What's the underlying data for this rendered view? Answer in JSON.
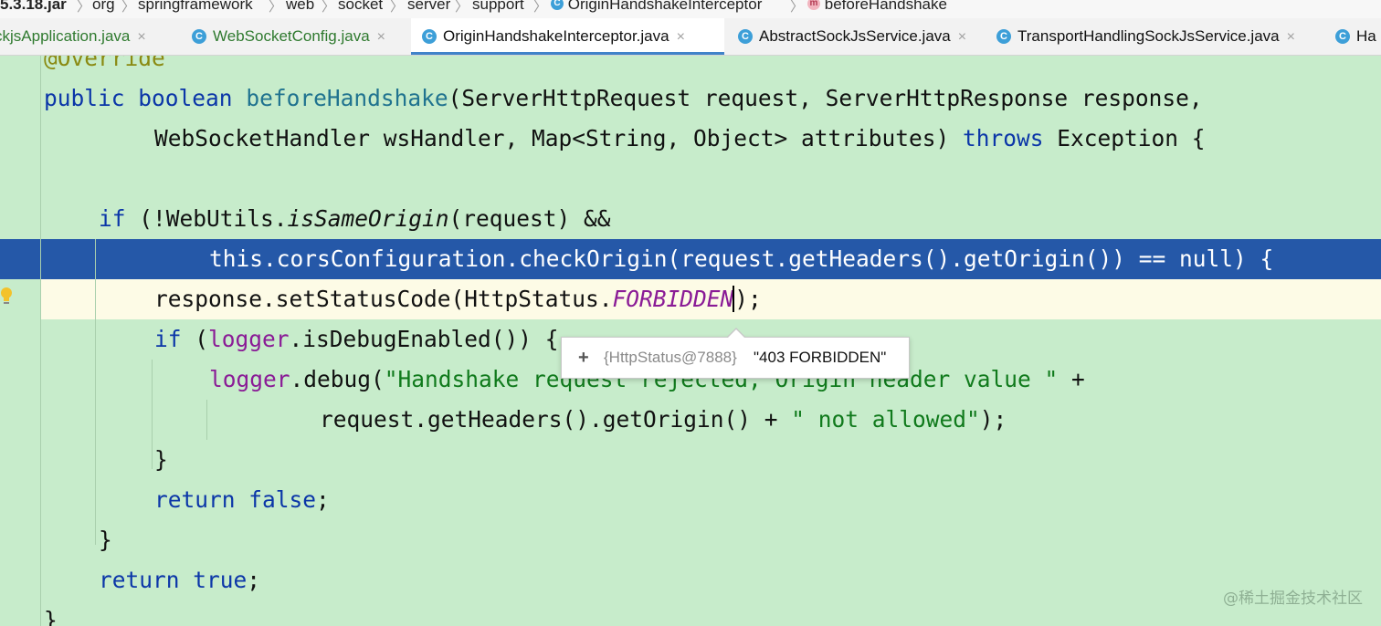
{
  "breadcrumb": {
    "jar": "5.3.18.jar",
    "parts": [
      "org",
      "springframework",
      "web",
      "socket",
      "server",
      "support"
    ],
    "class_name": "OriginHandshakeInterceptor",
    "method_name": "beforeHandshake",
    "class_icon": "C",
    "method_icon": "m"
  },
  "tabs": [
    {
      "label": "ckjsApplication.java"
    },
    {
      "label": "WebSocketConfig.java"
    },
    {
      "label": "OriginHandshakeInterceptor.java"
    },
    {
      "label": "AbstractSockJsService.java"
    },
    {
      "label": "TransportHandlingSockJsService.java"
    },
    {
      "label": "Ha"
    }
  ],
  "close_glyph": "×",
  "code": {
    "l1": {
      "ann": "@Override"
    },
    "l2": {
      "kw1": "public",
      "kw2": "boolean",
      "fn": "beforeHandshake",
      "rest": "(ServerHttpRequest request, ServerHttpResponse response,"
    },
    "l3": {
      "t1": "WebSocketHandler wsHandler, Map<String, Object> attributes) ",
      "kw": "throws",
      "t2": " Exception {"
    },
    "l4": {
      "kw": "if",
      "t1": " (!WebUtils.",
      "it": "isSameOrigin",
      "t2": "(request) &&"
    },
    "l5": {
      "t1": "this.corsConfiguration.checkOrigin(request.getHeaders().getOrigin()) == null) {"
    },
    "l6": {
      "t1": "response.setStatusCode(HttpStatus.",
      "fld": "FORBIDDEN",
      "t2": ");"
    },
    "l7": {
      "kw": "if",
      "t1": " (",
      "fld": "logger",
      "t2": ".isDebugEnabled()) {"
    },
    "l8": {
      "fld": "logger",
      "t1": ".debug(",
      "st": "\"Handshake request rejected, Origin header value \"",
      "t2": " +"
    },
    "l9": {
      "t1": "request.getHeaders().getOrigin() + ",
      "st": "\" not allowed\"",
      "t2": ");"
    },
    "l10": {
      "t1": "}"
    },
    "l11": {
      "kw1": "return",
      "sp": " ",
      "kw2": "false",
      "t1": ";"
    },
    "l12": {
      "t1": "}"
    },
    "l13": {
      "kw1": "return",
      "sp": " ",
      "kw2": "true",
      "t1": ";"
    },
    "l14": {
      "t1": "}"
    }
  },
  "tooltip": {
    "expand": "+",
    "ref": "{HttpStatus@7888}",
    "value": "\"403 FORBIDDEN\""
  },
  "watermark": "@稀土掘金技术社区",
  "colors": {
    "editor_bg": "#c7eccb",
    "selection": "#2558a8",
    "keyword": "#0b36a8",
    "string": "#107a1c",
    "field": "#8a1b96",
    "active_tab_underline": "#4083c9"
  }
}
